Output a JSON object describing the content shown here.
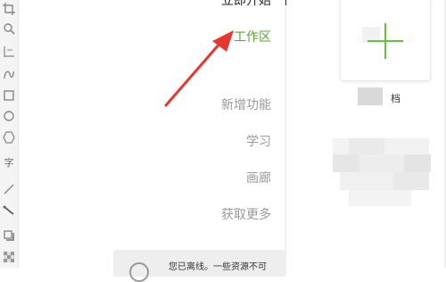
{
  "menu": {
    "partial_top_label": "立即开始",
    "items": [
      {
        "label": "工作区",
        "active": true
      },
      {
        "label": "新增功能",
        "active": false
      },
      {
        "label": "学习",
        "active": false
      },
      {
        "label": "画廊",
        "active": false
      },
      {
        "label": "获取更多",
        "active": false
      }
    ]
  },
  "offline_banner": {
    "text": "您已离线。一些资源不可"
  },
  "workspace": {
    "new_card_caption": "档"
  },
  "tools": [
    {
      "icon": "crop-icon"
    },
    {
      "icon": "zoom-icon"
    },
    {
      "icon": "dimension-icon"
    },
    {
      "icon": "freehand-icon"
    },
    {
      "icon": "rectangle-icon"
    },
    {
      "icon": "ellipse-icon"
    },
    {
      "icon": "polygon-icon"
    },
    {
      "icon": "text-tool-icon",
      "glyph": "字"
    },
    {
      "icon": "line-icon"
    },
    {
      "icon": "connector-icon"
    },
    {
      "icon": "shadow-icon"
    },
    {
      "icon": "transparency-icon"
    }
  ],
  "colors": {
    "active": "#5da233",
    "inactive": "#9a9a9a",
    "arrow": "#e8372f"
  }
}
